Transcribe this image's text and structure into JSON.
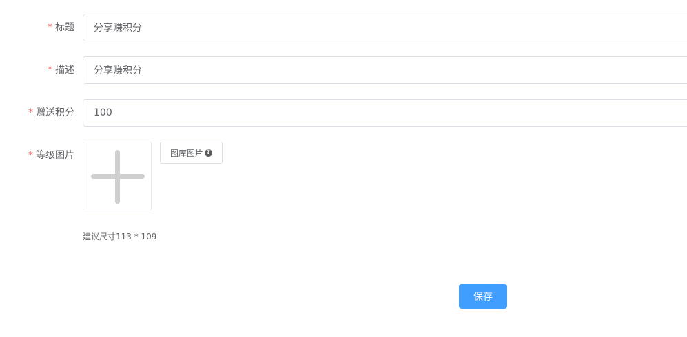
{
  "form": {
    "required_mark": "*",
    "title": {
      "label": "标题",
      "value": "分享赚积分"
    },
    "description": {
      "label": "描述",
      "value": "分享赚积分"
    },
    "points": {
      "label": "赠送积分",
      "value": "100"
    },
    "image": {
      "label": "等级图片",
      "library_button_label": "图库图片",
      "help_icon_glyph": "?",
      "size_hint": "建议尺寸113 * 109"
    },
    "save_label": "保存"
  },
  "colors": {
    "primary": "#409eff",
    "required": "#f56c6c",
    "border": "#dcdfe6",
    "text": "#606266",
    "placeholder_plus": "#cfcfcf"
  }
}
